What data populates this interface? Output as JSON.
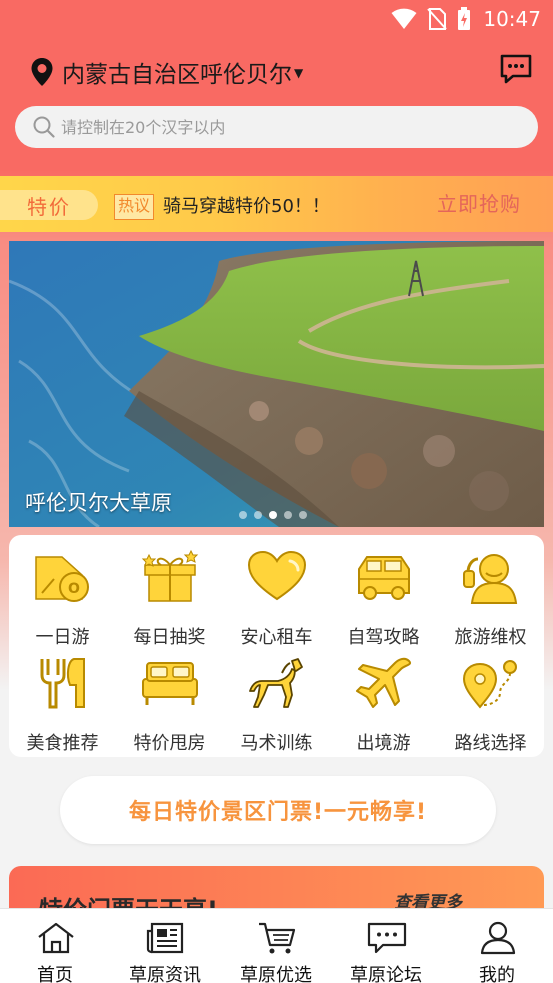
{
  "status_bar": {
    "time": "10:47"
  },
  "header": {
    "location": "内蒙古自治区呼伦贝尔",
    "search_placeholder": "请控制在20个汉字以内"
  },
  "promo": {
    "badge": "特价",
    "hot_tag": "热议",
    "text": "骑马穿越特价50！！",
    "action": "立即抢购"
  },
  "banner": {
    "caption": "呼伦贝尔大草原",
    "dot_count": 5,
    "active_dot": 3
  },
  "menu": [
    {
      "label": "一日游",
      "icon": "ticket-icon"
    },
    {
      "label": "每日抽奖",
      "icon": "gift-icon"
    },
    {
      "label": "安心租车",
      "icon": "heart-icon"
    },
    {
      "label": "自驾攻略",
      "icon": "car-icon"
    },
    {
      "label": "旅游维权",
      "icon": "support-icon"
    },
    {
      "label": "美食推荐",
      "icon": "cutlery-icon"
    },
    {
      "label": "特价甩房",
      "icon": "bed-icon"
    },
    {
      "label": "马术训练",
      "icon": "horse-icon"
    },
    {
      "label": "出境游",
      "icon": "airplane-icon"
    },
    {
      "label": "路线选择",
      "icon": "route-icon"
    }
  ],
  "ticket_banner": {
    "text": "每日特价景区门票!一元畅享!"
  },
  "feature_card": {
    "title": "特价门票天天享!",
    "more": "查看更多"
  },
  "tabs": [
    {
      "label": "首页",
      "icon": "home-icon"
    },
    {
      "label": "草原资讯",
      "icon": "news-icon"
    },
    {
      "label": "草原优选",
      "icon": "cart-icon"
    },
    {
      "label": "草原论坛",
      "icon": "forum-icon"
    },
    {
      "label": "我的",
      "icon": "user-icon"
    }
  ],
  "colors": {
    "header_red": "#f96a63",
    "icon_yellow": "#ffd43a",
    "accent_orange": "#f7943e"
  }
}
